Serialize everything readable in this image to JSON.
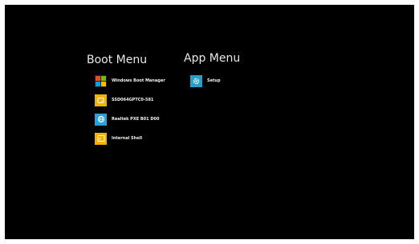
{
  "boot_menu": {
    "title": "Boot Menu",
    "items": [
      {
        "label": "Windows Boot Manager",
        "icon": "windows-logo-icon",
        "color": "#d04a1e"
      },
      {
        "label": "SSD064GPTC0-581",
        "icon": "drive-icon",
        "color": "#f0b400"
      },
      {
        "label": "Realtek PXE B01 D00",
        "icon": "network-icon",
        "color": "#2aa1d8"
      },
      {
        "label": "Internal Shell",
        "icon": "shell-icon",
        "color": "#f0b400"
      }
    ]
  },
  "app_menu": {
    "title": "App Menu",
    "items": [
      {
        "label": "Setup",
        "icon": "gear-icon",
        "color": "#27a0c9"
      }
    ]
  },
  "colors": {
    "background": "#000000",
    "text": "#e8e8e8"
  }
}
